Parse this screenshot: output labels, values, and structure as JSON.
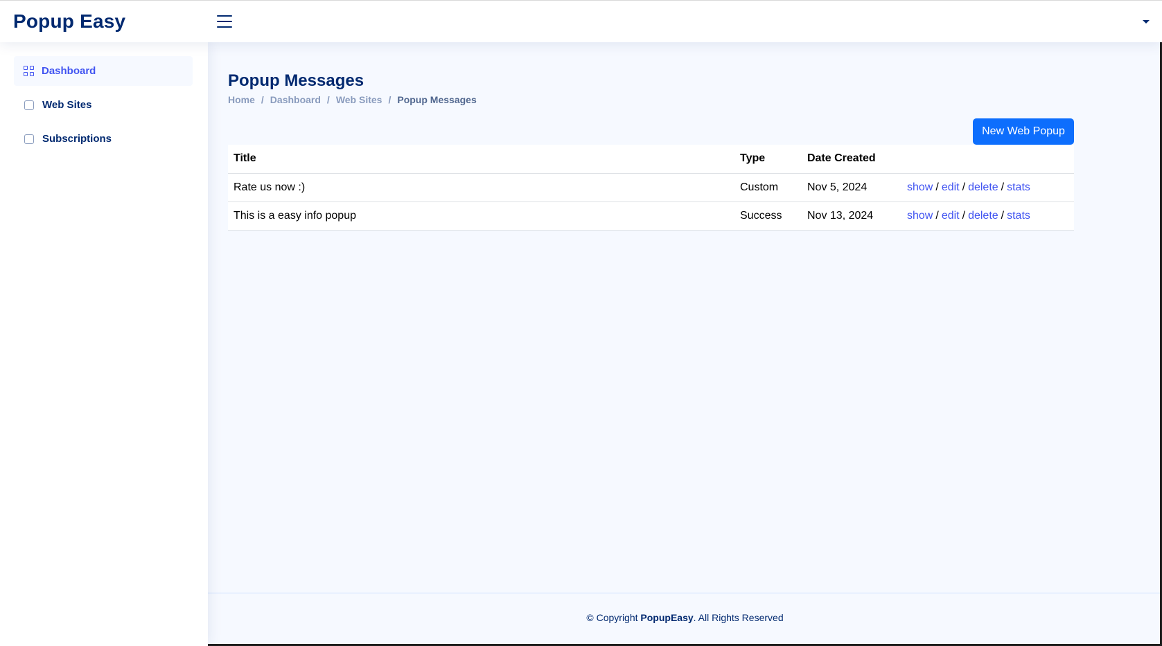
{
  "header": {
    "logo": "Popup Easy"
  },
  "sidebar": {
    "items": [
      {
        "label": "Dashboard",
        "icon": "grid-icon",
        "active": true
      },
      {
        "label": "Web Sites",
        "icon": "square-icon",
        "active": false
      },
      {
        "label": "Subscriptions",
        "icon": "square-icon",
        "active": false
      }
    ]
  },
  "main": {
    "title": "Popup Messages",
    "breadcrumb": [
      "Home",
      "Dashboard",
      "Web Sites",
      "Popup Messages"
    ],
    "new_button_label": "New Web Popup",
    "table": {
      "headers": [
        "Title",
        "Type",
        "Date Created",
        ""
      ],
      "rows": [
        {
          "title": "Rate us now :)",
          "type": "Custom",
          "date": "Nov 5, 2024"
        },
        {
          "title": "This is a easy info popup",
          "type": "Success",
          "date": "Nov 13, 2024"
        }
      ],
      "actions": {
        "show": "show",
        "edit": "edit",
        "delete": "delete",
        "stats": "stats",
        "separator": "/"
      }
    }
  },
  "footer": {
    "prefix": "© Copyright ",
    "brand": "PopupEasy",
    "suffix": ". All Rights Reserved"
  },
  "colors": {
    "primary": "#012970",
    "accent": "#4154f1",
    "button": "#0d6efd",
    "background": "#f6f9ff"
  }
}
